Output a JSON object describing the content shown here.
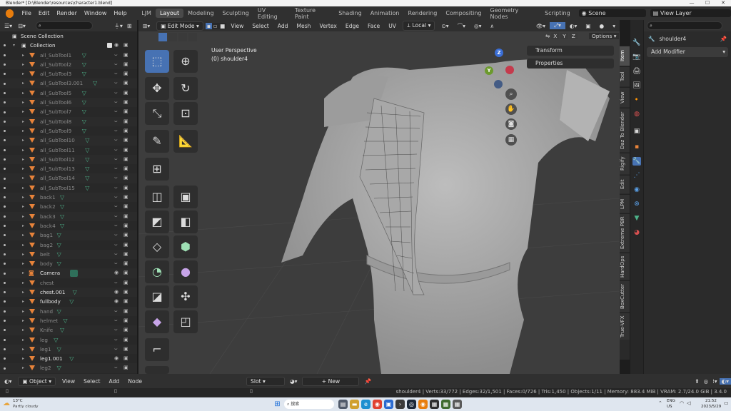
{
  "titlebar": {
    "title": "Blender* [D:\\Blender\\resources\\character1.blend]",
    "minimize": "—",
    "maximize": "☐",
    "close": "✕"
  },
  "menu": {
    "items": [
      "File",
      "Edit",
      "Render",
      "Window",
      "Help"
    ]
  },
  "workspaces": [
    "LJM",
    "Layout",
    "Modeling",
    "Sculpting",
    "UV Editing",
    "Texture Paint",
    "Shading",
    "Animation",
    "Rendering",
    "Compositing",
    "Geometry Nodes",
    "Scripting"
  ],
  "active_workspace": "Layout",
  "scene": {
    "label": "Scene",
    "view_layer": "View Layer"
  },
  "outliner": {
    "root": "Scene Collection",
    "collection": "Collection",
    "rows": [
      {
        "name": "all_SubTool1",
        "dim": true,
        "mods": true
      },
      {
        "name": "all_SubTool2",
        "dim": true,
        "mods": true
      },
      {
        "name": "all_SubTool3",
        "dim": true,
        "mods": true
      },
      {
        "name": "all_SubTool3.001",
        "dim": true,
        "mods": true
      },
      {
        "name": "all_SubTool5",
        "dim": true,
        "mods": true
      },
      {
        "name": "all_SubTool6",
        "dim": true,
        "mods": true
      },
      {
        "name": "all_SubTool7",
        "dim": true,
        "mods": true
      },
      {
        "name": "all_SubTool8",
        "dim": true,
        "mods": true
      },
      {
        "name": "all_SubTool9",
        "dim": true,
        "mods": true
      },
      {
        "name": "all_SubTool10",
        "dim": true,
        "mods": true
      },
      {
        "name": "all_SubTool11",
        "dim": true,
        "mods": true
      },
      {
        "name": "all_SubTool12",
        "dim": true,
        "mods": true
      },
      {
        "name": "all_SubTool13",
        "dim": true,
        "mods": true
      },
      {
        "name": "all_SubTool14",
        "dim": true,
        "mods": true
      },
      {
        "name": "all_SubTool15",
        "dim": true,
        "mods": true
      },
      {
        "name": "back1",
        "dim": true,
        "mods": true
      },
      {
        "name": "back2",
        "dim": true,
        "mods": true
      },
      {
        "name": "back3",
        "dim": true,
        "mods": true
      },
      {
        "name": "back4",
        "dim": true,
        "mods": true
      },
      {
        "name": "bag1",
        "dim": true,
        "mods": true
      },
      {
        "name": "bag2",
        "dim": true,
        "mods": true
      },
      {
        "name": "belt",
        "dim": true,
        "mods": true
      },
      {
        "name": "body",
        "dim": true,
        "mods": true
      },
      {
        "name": "Camera",
        "dim": false,
        "mods": false,
        "camera": true
      },
      {
        "name": "chest",
        "dim": true,
        "mods": false
      },
      {
        "name": "chest.001",
        "dim": false,
        "mods": true
      },
      {
        "name": "fullbody",
        "dim": false,
        "mods": true
      },
      {
        "name": "hand",
        "dim": true,
        "mods": true
      },
      {
        "name": "helmet",
        "dim": true,
        "mods": true
      },
      {
        "name": "Knife",
        "dim": true,
        "mods": true
      },
      {
        "name": "leg",
        "dim": true,
        "mods": true
      },
      {
        "name": "leg1",
        "dim": true,
        "mods": true
      },
      {
        "name": "leg1.001",
        "dim": false,
        "mods": true
      },
      {
        "name": "leg2",
        "dim": true,
        "mods": true
      }
    ]
  },
  "viewport": {
    "mode": "Edit Mode",
    "menus": [
      "View",
      "Select",
      "Add",
      "Mesh",
      "Vertex",
      "Edge",
      "Face",
      "UV"
    ],
    "transform_orientation": "Local",
    "info_line1": "User Perspective",
    "info_line2": "(0) shoulder4",
    "axes": [
      "X",
      "Y",
      "Z"
    ],
    "options": "Options",
    "panels": [
      "Transform",
      "Properties"
    ]
  },
  "ntabs": [
    "Item",
    "Tool",
    "View",
    "Daz To Blender",
    "Rigify",
    "Edit",
    "LPM",
    "Extreme PBR",
    "HardOps",
    "BoxCutter",
    "True-VFX"
  ],
  "properties": {
    "object_name": "shoulder4",
    "add_modifier": "Add Modifier"
  },
  "bottombar": {
    "object_menu": "Object",
    "menus": [
      "View",
      "Select",
      "Add",
      "Node"
    ],
    "slot": "Slot",
    "new": "New"
  },
  "statusbar": {
    "text": "shoulder4 | Verts:33/772 | Edges:32/1,501 | Faces:0/726 | Tris:1,450 | Objects:1/11 | Memory: 883.4 MiB | VRAM: 2.7/24.0 GiB | 3.4.0"
  },
  "taskbar": {
    "weather_temp": "13°C",
    "weather_desc": "Partly cloudy",
    "search": "搜索",
    "lang": "ENG",
    "region": "US",
    "time": "21:52",
    "date": "2023/5/29"
  },
  "colors": {
    "accent": "#4772b3",
    "object_orange": "#e8833a",
    "modifier_green": "#4db38a",
    "viewport_bg": "#3d3d3d"
  }
}
